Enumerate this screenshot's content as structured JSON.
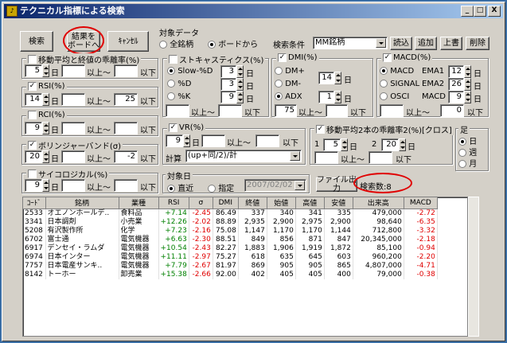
{
  "window": {
    "title": "テクニカル指標による検索",
    "icon": "chart-app-icon",
    "minimize": "_",
    "maximize": "□",
    "close": "X"
  },
  "toolbar": {
    "search": "検索",
    "to_board_1": "結果を",
    "to_board_2": "ボードへ",
    "cancel": "ｷｬﾝｾﾙ"
  },
  "target_data": {
    "label": "対象データ",
    "all": "全銘柄",
    "board": "ボードから"
  },
  "conditions": {
    "label": "検索条件",
    "selected": "MM銘柄",
    "load": "読込",
    "add": "追加",
    "overwrite": "上書",
    "delete": "削除"
  },
  "ma_dev": {
    "label": "移動平均と終値の乖離率(%)",
    "days": "5",
    "unit": "日",
    "above": "以上～",
    "below": "以下",
    "min": "",
    "max": ""
  },
  "rsi": {
    "label": "RSI(%)",
    "days": "14",
    "unit": "日",
    "above": "以上～",
    "below": "以下",
    "min": "",
    "max": "25"
  },
  "rci": {
    "label": "RCI(%)",
    "days": "9",
    "unit": "日",
    "above": "以上～",
    "below": "以下",
    "min": "",
    "max": ""
  },
  "bollinger": {
    "label": "ボリンジャーバンド(σ)",
    "days": "20",
    "unit": "日",
    "above": "以上～",
    "below": "以下",
    "min": "",
    "max": "-2"
  },
  "psycho": {
    "label": "サイコロジカル(%)",
    "days": "9",
    "unit": "日",
    "above": "以上～",
    "below": "以下",
    "min": "",
    "max": ""
  },
  "stoch": {
    "label": "ストキャスティクス(%)",
    "slow": "Slow-%D",
    "d": "%D",
    "k": "%K",
    "slow_val": "3",
    "d_val": "3",
    "k_val": "9",
    "unit": "日",
    "above": "以上～",
    "below": "以下"
  },
  "dmi": {
    "label": "DMI(%)",
    "plus": "DM+",
    "minus": "DM-",
    "adx": "ADX",
    "days": "14",
    "adx_days": "1",
    "unit": "日",
    "above": "以上～",
    "below": "以下",
    "min": "75",
    "max": ""
  },
  "macd": {
    "label": "MACD(%)",
    "macd": "MACD",
    "signal": "SIGNAL",
    "osci": "OSCI",
    "ema1_label": "EMA1",
    "ema2_label": "EMA2",
    "macd_label": "MACD",
    "ema1": "12",
    "ema2": "26",
    "macd_val": "9",
    "unit": "日",
    "above": "以上～",
    "below": "以下",
    "min": "",
    "max": "0"
  },
  "vr": {
    "label": "VR(%)",
    "days": "9",
    "unit": "日",
    "above": "以上～",
    "below": "以下",
    "calc_label": "計算",
    "calc": "(up+同/2)/計"
  },
  "ma_cross": {
    "label": "移動平均2本の乖離率2(%)[クロス]",
    "n1": "1",
    "d1": "5",
    "n2": "2",
    "d2": "20",
    "unit": "日",
    "above": "以上～",
    "below": "以下"
  },
  "foot": {
    "label": "足",
    "day": "日",
    "week": "週",
    "month": "月"
  },
  "target_date": {
    "label": "対象日",
    "recent": "直近",
    "specified": "指定",
    "date": "2007/02/02"
  },
  "file_output": "ファイル出力",
  "result_count": "検索数:8",
  "table": {
    "headers": [
      "ｺｰﾄﾞ",
      "銘柄",
      "業種",
      "RSI",
      "σ",
      "DMI",
      "終値",
      "始値",
      "高値",
      "安値",
      "出来高",
      "MACD"
    ],
    "rows": [
      [
        "2533",
        "オエノンホールデ..",
        "食料品",
        "+7.14",
        "-2.45",
        "86.49",
        "337",
        "340",
        "341",
        "335",
        "479,000",
        "-2.72"
      ],
      [
        "3341",
        "日本調剤",
        "小売業",
        "+12.26",
        "-2.02",
        "88.89",
        "2,935",
        "2,900",
        "2,975",
        "2,900",
        "98,640",
        "-6.35"
      ],
      [
        "5208",
        "有沢製作所",
        "化学",
        "+7.23",
        "-2.16",
        "75.08",
        "1,147",
        "1,170",
        "1,170",
        "1,144",
        "712,800",
        "-3.32"
      ],
      [
        "6702",
        "富士通",
        "電気機器",
        "+6.63",
        "-2.30",
        "88.51",
        "849",
        "856",
        "871",
        "847",
        "20,345,000",
        "-2.18"
      ],
      [
        "6917",
        "デンセイ・ラムダ",
        "電気機器",
        "+10.54",
        "-2.43",
        "82.27",
        "1,883",
        "1,906",
        "1,919",
        "1,872",
        "85,100",
        "-0.94"
      ],
      [
        "6974",
        "日本インター",
        "電気機器",
        "+11.11",
        "-2.97",
        "75.27",
        "618",
        "635",
        "645",
        "603",
        "960,200",
        "-2.20"
      ],
      [
        "7757",
        "日本電産サンキ..",
        "電気機器",
        "+7.79",
        "-2.67",
        "81.97",
        "869",
        "905",
        "905",
        "865",
        "4,807,000",
        "-4.71"
      ],
      [
        "8142",
        "トーホー",
        "卸売業",
        "+15.38",
        "-2.66",
        "92.00",
        "402",
        "405",
        "405",
        "400",
        "79,000",
        "-0.38"
      ]
    ]
  },
  "colors": {
    "title_start": "#0a246a",
    "title_end": "#a6caf0",
    "positive": "#008000",
    "negative": "#e00000",
    "highlight": "#e00000"
  }
}
